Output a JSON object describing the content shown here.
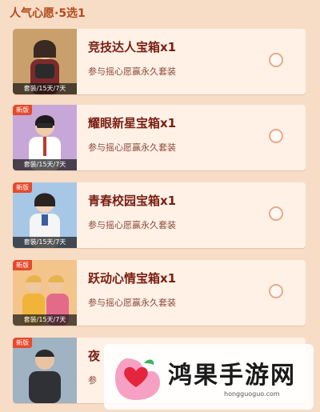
{
  "header": {
    "title": "人气心愿·5选1"
  },
  "items": [
    {
      "title": "竞技达人宝箱x1",
      "sub": "参与摇心愿赢永久套装",
      "durations": "套装/15天/7天",
      "tag": "",
      "theme": "#c9a06b",
      "skin": "#f2cfb0",
      "hair": "#3a2a22",
      "outfit": "#7b2b2b"
    },
    {
      "title": "耀眼新星宝箱x1",
      "sub": "参与摇心愿赢永久套装",
      "durations": "套装/15天/7天",
      "tag": "新版",
      "theme": "#c7a7d8",
      "skin": "#f0cda9",
      "hair": "#1f1b1b",
      "outfit": "#ffffff"
    },
    {
      "title": "青春校园宝箱x1",
      "sub": "参与摇心愿赢永久套装",
      "durations": "套装/15天/7天",
      "tag": "新版",
      "theme": "#a7c7e7",
      "skin": "#f2d3b9",
      "hair": "#2b2320",
      "outfit": "#f5f5f5"
    },
    {
      "title": "跃动心情宝箱x1",
      "sub": "参与摇心愿赢永久套装",
      "durations": "套装/15天/7天",
      "tag": "新版",
      "theme": "#f3c48b",
      "skin": "#f0c89f",
      "hair": "#e6b34d",
      "outfit": "#f1b43b"
    },
    {
      "title": "夜",
      "sub": "参",
      "durations": "",
      "tag": "新版",
      "theme": "#9fb3c2",
      "skin": "#e9c4a4",
      "hair": "#2a2a2a",
      "outfit": "#2f3136"
    }
  ],
  "watermark": {
    "text": "鸿果手游网",
    "url": "hongguoguo.com"
  }
}
